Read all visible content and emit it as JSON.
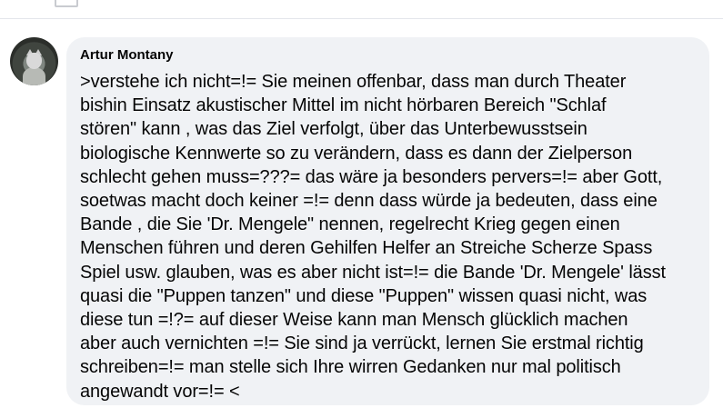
{
  "comment": {
    "author": "Artur Montany",
    "avatar_icon": "profile-photo-cat",
    "text": ">verstehe ich nicht=!= Sie meinen offenbar, dass man durch Theater\nbishin Einsatz  akustischer Mittel im nicht hörbaren Bereich  \"Schlaf\nstören\" kann , was das Ziel verfolgt, über das Unterbewusstsein\nbiologische Kennwerte so zu verändern, dass es dann der Zielperson\nschlecht gehen muss=???= das wäre ja besonders pervers=!= aber Gott,\nsoetwas macht doch keiner =!= denn dass würde ja bedeuten, dass eine\nBande , die Sie 'Dr. Mengele\" nennen, regelrecht Krieg gegen einen\nMenschen führen und deren Gehilfen Helfer an Streiche Scherze Spass\nSpiel usw. glauben, was es aber nicht ist=!= die Bande 'Dr. Mengele' lässt\nquasi die \"Puppen tanzen\" und  diese \"Puppen\" wissen quasi nicht, was\ndiese tun =!?= auf dieser Weise kann man Mensch glücklich machen\naber auch vernichten =!= Sie sind ja verrückt, lernen Sie erstmal richtig\nschreiben=!= man stelle sich Ihre wirren Gedanken nur mal politisch\nangewandt vor=!= <"
  },
  "colors": {
    "bubble_background": "#f0f2f5",
    "text": "#050505",
    "divider": "#e4e6eb"
  }
}
